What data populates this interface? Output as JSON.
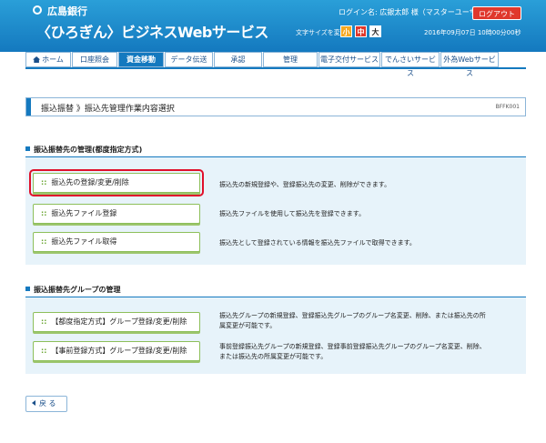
{
  "header": {
    "bank_name": "広島銀行",
    "service_title": "〈ひろぎん〉ビジネスWebサービス",
    "login_info": "ログイン名: 広銀太郎 様（マスターユーザ）",
    "logout_label": "ログアウト",
    "fontsize_label": "文字サイズを変更",
    "fontsize_small": "小",
    "fontsize_mid": "中",
    "fontsize_large": "大",
    "datetime": "2016年09月07日 10時00分00秒"
  },
  "nav": {
    "items": [
      {
        "label": "ホーム"
      },
      {
        "label": "口座照会"
      },
      {
        "label": "資金移動"
      },
      {
        "label": "データ伝送"
      },
      {
        "label": "承認"
      },
      {
        "label": "管理"
      },
      {
        "label": "電子交付サービス"
      },
      {
        "label": "でんさいサービス"
      },
      {
        "label": "外為Webサービス"
      }
    ]
  },
  "breadcrumb": {
    "text": "振込振替 》振込先管理作業内容選択",
    "screen_id": "BFFK001"
  },
  "section1": {
    "heading": "振込振替先の管理(都度指定方式)",
    "rows": [
      {
        "button": "振込先の登録/変更/削除",
        "desc": "振込先の新規登録や、登録振込先の変更、削除ができます。"
      },
      {
        "button": "振込先ファイル登録",
        "desc": "振込先ファイルを使用して振込先を登録できます。"
      },
      {
        "button": "振込先ファイル取得",
        "desc": "振込先として登録されている情報を振込先ファイルで取得できます。"
      }
    ]
  },
  "section2": {
    "heading": "振込振替先グループの管理",
    "rows": [
      {
        "button": "【都度指定方式】グループ登録/変更/削除",
        "desc1": "振込先グループの新規登録、登録振込先グループのグループ名変更、削除、または振込先の所",
        "desc2": "属変更が可能です。"
      },
      {
        "button": "【事前登録方式】グループ登録/変更/削除",
        "desc1": "事前登録振込先グループの新規登録、登録事前登録振込先グループのグループ名変更、削除、",
        "desc2": "または振込先の所属変更が可能です。"
      }
    ]
  },
  "back_label": "戻 る",
  "colors": {
    "header_blue": "#1479bf",
    "button_green": "#8dbf5a",
    "highlight_red": "#e0102a",
    "panel_bg": "#e7f3fa"
  }
}
